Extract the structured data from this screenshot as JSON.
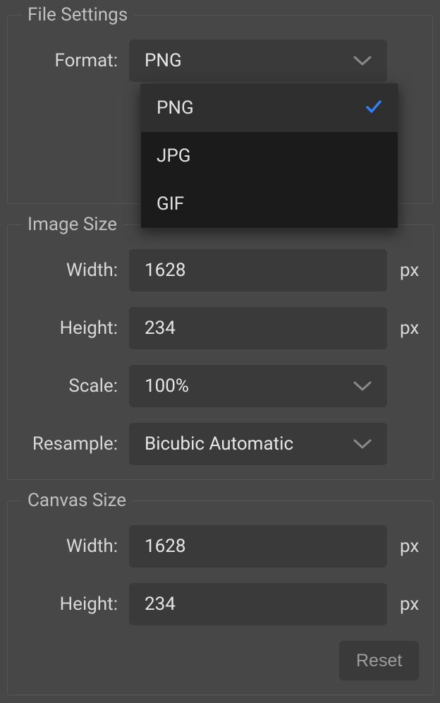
{
  "file_settings": {
    "legend": "File Settings",
    "format_label": "Format:",
    "format_value": "PNG",
    "options": [
      {
        "label": "PNG",
        "selected": true
      },
      {
        "label": "JPG",
        "selected": false
      },
      {
        "label": "GIF",
        "selected": false
      }
    ]
  },
  "image_size": {
    "legend": "Image Size",
    "width_label": "Width:",
    "width_value": "1628",
    "width_unit": "px",
    "height_label": "Height:",
    "height_value": "234",
    "height_unit": "px",
    "scale_label": "Scale:",
    "scale_value": "100%",
    "resample_label": "Resample:",
    "resample_value": "Bicubic Automatic"
  },
  "canvas_size": {
    "legend": "Canvas Size",
    "width_label": "Width:",
    "width_value": "1628",
    "width_unit": "px",
    "height_label": "Height:",
    "height_value": "234",
    "height_unit": "px",
    "reset_label": "Reset"
  }
}
